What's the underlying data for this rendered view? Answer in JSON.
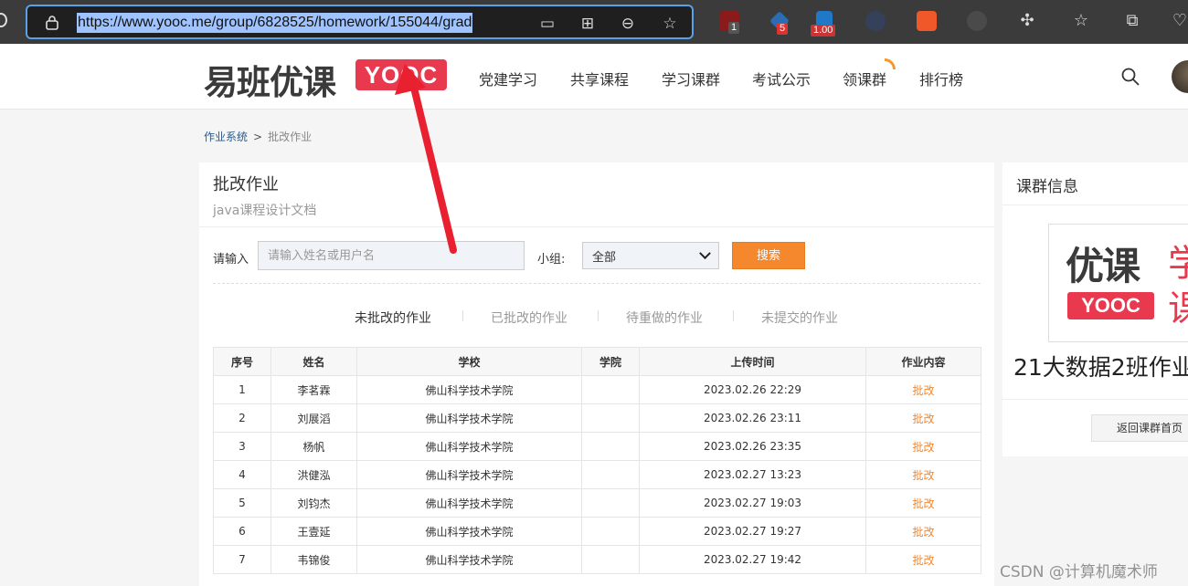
{
  "browser": {
    "url": "https://www.yooc.me/group/6828525/homework/155044/grad",
    "ext_badges": [
      "1",
      "5",
      "1.00"
    ]
  },
  "site": {
    "logo_text": "易班优课",
    "logo_badge": "YOOC",
    "nav": [
      "党建学习",
      "共享课程",
      "学习课群",
      "考试公示",
      "领课群",
      "排行榜"
    ]
  },
  "breadcrumb": {
    "root": "作业系统",
    "separator": ">",
    "current": "批改作业"
  },
  "main": {
    "title": "批改作业",
    "subtitle": "java课程设计文档",
    "search_label": "请输入",
    "search_placeholder": "请输入姓名或用户名",
    "group_label": "小组:",
    "group_value": "全部",
    "search_button": "搜索",
    "tabs": [
      "未批改的作业",
      "已批改的作业",
      "待重做的作业",
      "未提交的作业"
    ],
    "active_tab": 0
  },
  "table": {
    "headers": [
      "序号",
      "姓名",
      "学校",
      "学院",
      "上传时间",
      "作业内容"
    ],
    "rows": [
      {
        "no": "1",
        "name": "李茗霖",
        "school": "佛山科学技术学院",
        "college": "",
        "time": "2023.02.26 22:29",
        "action": "批改"
      },
      {
        "no": "2",
        "name": "刘展滔",
        "school": "佛山科学技术学院",
        "college": "",
        "time": "2023.02.26 23:11",
        "action": "批改"
      },
      {
        "no": "3",
        "name": "杨帆",
        "school": "佛山科学技术学院",
        "college": "",
        "time": "2023.02.26 23:35",
        "action": "批改"
      },
      {
        "no": "4",
        "name": "洪健泓",
        "school": "佛山科学技术学院",
        "college": "",
        "time": "2023.02.27 13:23",
        "action": "批改"
      },
      {
        "no": "5",
        "name": "刘钧杰",
        "school": "佛山科学技术学院",
        "college": "",
        "time": "2023.02.27 19:03",
        "action": "批改"
      },
      {
        "no": "6",
        "name": "王壹延",
        "school": "佛山科学技术学院",
        "college": "",
        "time": "2023.02.27 19:27",
        "action": "批改"
      },
      {
        "no": "7",
        "name": "韦锦俊",
        "school": "佛山科学技术学院",
        "college": "",
        "time": "2023.02.27 19:42",
        "action": "批改"
      }
    ]
  },
  "side": {
    "title": "课群信息",
    "image_big_text": "优课",
    "image_red_1": "学",
    "image_red_2": "课",
    "image_badge": "YOOC",
    "group_name": "21大数据2班作业",
    "back_button": "返回课群首页"
  },
  "watermark": "CSDN @计算机魔术师",
  "colors": {
    "accent_orange": "#f5872c",
    "brand_red": "#e9394f",
    "annotation_red": "#e8202f"
  }
}
